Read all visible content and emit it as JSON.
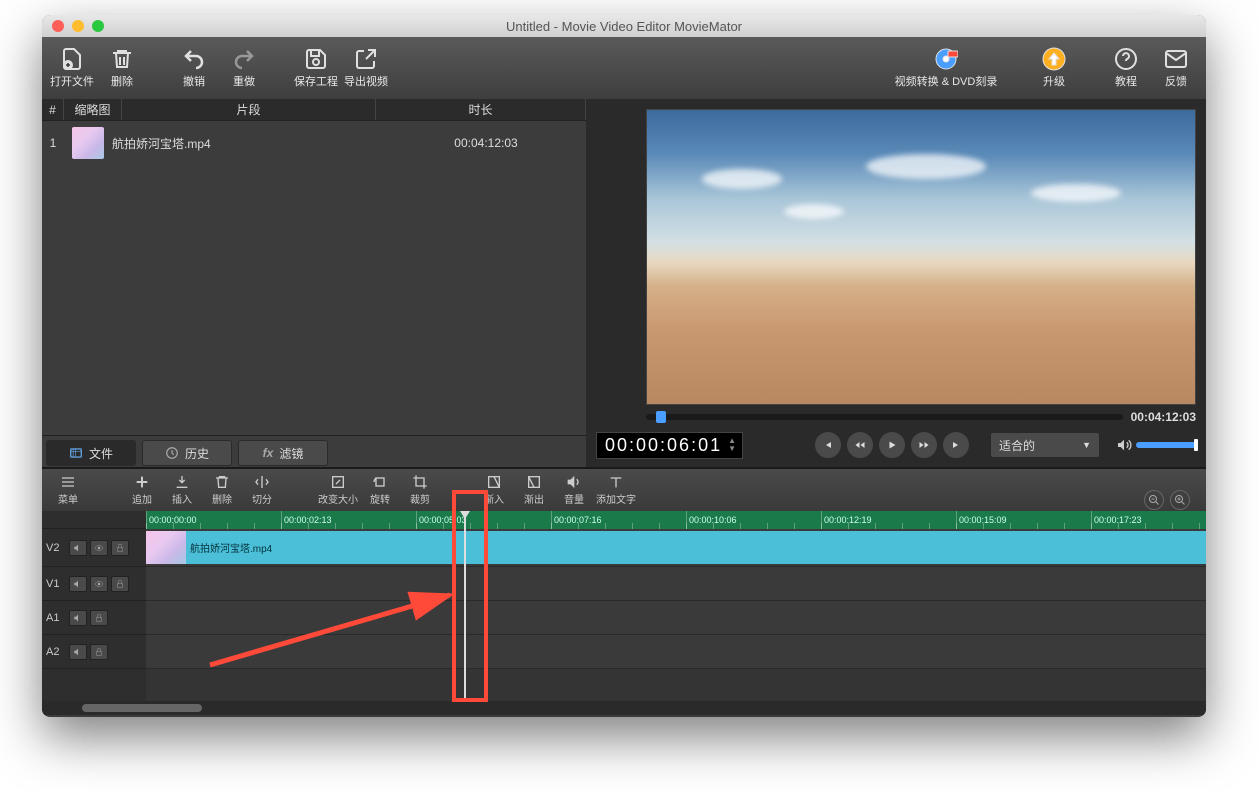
{
  "window": {
    "title": "Untitled - Movie Video Editor MovieMator"
  },
  "toolbar": {
    "open": "打开文件",
    "delete": "删除",
    "undo": "撤销",
    "redo": "重做",
    "save": "保存工程",
    "export": "导出视频",
    "convert": "视频转换 & DVD刻录",
    "upgrade": "升级",
    "tutorial": "教程",
    "feedback": "反馈"
  },
  "playlist": {
    "headers": {
      "index": "#",
      "thumb": "缩略图",
      "clip": "片段",
      "duration": "时长"
    },
    "rows": [
      {
        "index": "1",
        "name": "航拍娇河宝塔.mp4",
        "duration": "00:04:12:03"
      }
    ],
    "tabs": {
      "file": "文件",
      "history": "历史",
      "filters": "滤镜"
    }
  },
  "preview": {
    "total_time": "00:04:12:03",
    "timecode": "00:00:06:01",
    "fit_label": "适合的"
  },
  "tl_toolbar": {
    "menu": "菜单",
    "append": "追加",
    "insert": "插入",
    "delete": "删除",
    "split": "切分",
    "resize": "改变大小",
    "rotate": "旋转",
    "crop": "裁剪",
    "fadein": "渐入",
    "fadeout": "渐出",
    "volume": "音量",
    "text": "添加文字"
  },
  "ruler": [
    "00:00:00:00",
    "00:00:02:13",
    "00:00:05:03",
    "00:00:07:16",
    "00:00:10:06",
    "00:00:12:19",
    "00:00:15:09",
    "00:00:17:23"
  ],
  "tracks": {
    "v2": "V2",
    "v1": "V1",
    "a1": "A1",
    "a2": "A2"
  },
  "clip": {
    "name": "航拍娇河宝塔.mp4"
  }
}
